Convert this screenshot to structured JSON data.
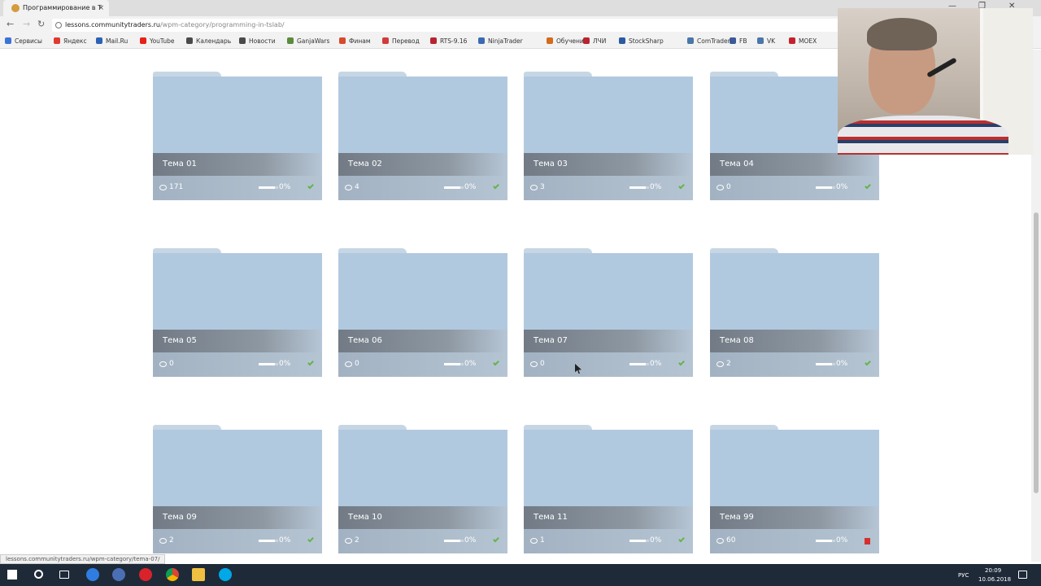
{
  "browser": {
    "tab_title": "Программирование в T",
    "tab_close": "×",
    "url_host": "lessons.communitytraders.ru",
    "url_path": "/wpm-category/programming-in-tslab/",
    "window_controls": [
      "—",
      "❐",
      "✕"
    ],
    "bookmarks": [
      {
        "label": "Сервисы",
        "color": "#3b73d9"
      },
      {
        "label": "Яндекс",
        "color": "#e03a30"
      },
      {
        "label": "Mail.Ru",
        "color": "#2b62b6"
      },
      {
        "label": "YouTube",
        "color": "#e62117"
      },
      {
        "label": "Календарь",
        "color": "#4a4a4a"
      },
      {
        "label": "Новости",
        "color": "#4a4a4a"
      },
      {
        "label": "GanjaWars",
        "color": "#5b8a3c"
      },
      {
        "label": "Финам",
        "color": "#d74a2a"
      },
      {
        "label": "Перевод",
        "color": "#d23a3a"
      },
      {
        "label": "RTS-9.16",
        "color": "#b8232f"
      },
      {
        "label": "NinjaTrader",
        "color": "#3a6ab3"
      },
      {
        "label": "Обучение",
        "color": "#d46a1a"
      },
      {
        "label": "ЛЧИ",
        "color": "#b8232f"
      },
      {
        "label": "StockSharp",
        "color": "#2a5aa0"
      },
      {
        "label": "ComTraders",
        "color": "#4a76a8"
      },
      {
        "label": "FB",
        "color": "#3b5998"
      },
      {
        "label": "VK",
        "color": "#4a76a8"
      },
      {
        "label": "MOEX",
        "color": "#c6202f"
      }
    ],
    "status_url": "lessons.communitytraders.ru/wpm-category/tema-07/"
  },
  "cards": [
    {
      "title": "Тема 01",
      "views": "171",
      "progress": 0,
      "pct": "0%",
      "status": "check"
    },
    {
      "title": "Тема 02",
      "views": "4",
      "progress": 0,
      "pct": "0%",
      "status": "check"
    },
    {
      "title": "Тема 03",
      "views": "3",
      "progress": 0,
      "pct": "0%",
      "status": "check"
    },
    {
      "title": "Тема 04",
      "views": "0",
      "progress": 0,
      "pct": "0%",
      "status": "check"
    },
    {
      "title": "Тема 05",
      "views": "0",
      "progress": 0,
      "pct": "0%",
      "status": "check"
    },
    {
      "title": "Тема 06",
      "views": "0",
      "progress": 0,
      "pct": "0%",
      "status": "check"
    },
    {
      "title": "Тема 07",
      "views": "0",
      "progress": 0,
      "pct": "0%",
      "status": "check"
    },
    {
      "title": "Тема 08",
      "views": "2",
      "progress": 0,
      "pct": "0%",
      "status": "check"
    },
    {
      "title": "Тема 09",
      "views": "2",
      "progress": 0,
      "pct": "0%",
      "status": "check"
    },
    {
      "title": "Тема 10",
      "views": "2",
      "progress": 0,
      "pct": "0%",
      "status": "check"
    },
    {
      "title": "Тема 11",
      "views": "1",
      "progress": 0,
      "pct": "0%",
      "status": "check"
    },
    {
      "title": "Тема 99",
      "views": "60",
      "progress": 0,
      "pct": "0%",
      "status": "flag"
    }
  ],
  "taskbar": {
    "lang": "РУС",
    "time": "20:09",
    "date": "10.06.2018"
  },
  "colors": {
    "folder": "#b1c9df",
    "check": "#62b44b",
    "flag": "#d62f2f"
  }
}
